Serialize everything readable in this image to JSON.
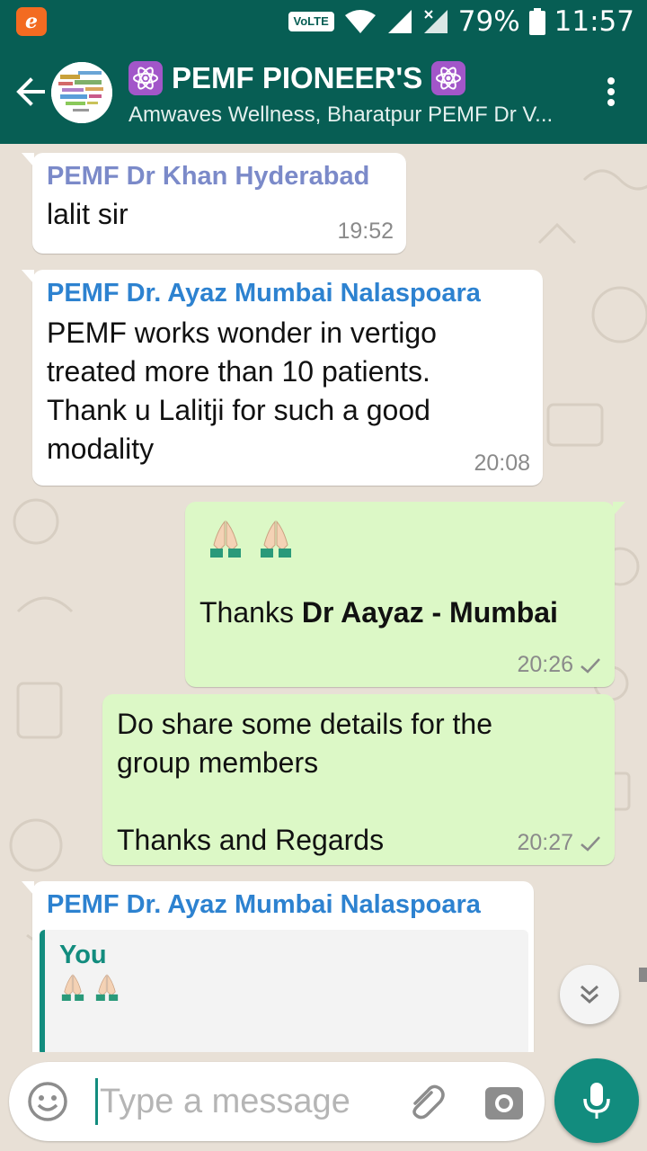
{
  "status_bar": {
    "network": "VoLTE",
    "battery": "79%",
    "time": "11:57"
  },
  "header": {
    "title": "PEMF PIONEER'S",
    "subtitle": "Amwaves Wellness, Bharatpur PEMF Dr V...",
    "icons": [
      "back-arrow-icon",
      "atom-icon",
      "more-vert-icon"
    ]
  },
  "messages": [
    {
      "direction": "incoming",
      "sender": "PEMF Dr Khan Hyderabad",
      "sender_color": "#7b8ac9",
      "text": "lalit sir",
      "time": "19:52"
    },
    {
      "direction": "incoming",
      "sender": "PEMF Dr. Ayaz Mumbai Nalaspoara",
      "sender_color": "#2d82d0",
      "lines": [
        "PEMF works wonder in vertigo",
        "treated more than 10 patients.",
        "Thank u Lalitji for such a good",
        "modality"
      ],
      "time": "20:08"
    },
    {
      "direction": "outgoing",
      "emoji": "folded-hands-icon",
      "text_plain": "Thanks ",
      "text_bold": "Dr Aayaz - Mumbai",
      "time": "20:26",
      "status": "sent"
    },
    {
      "direction": "outgoing",
      "lines": [
        "Do share some details for the",
        "group members",
        "",
        "Thanks and Regards"
      ],
      "time": "20:27",
      "status": "sent"
    },
    {
      "direction": "incoming",
      "sender": "PEMF Dr. Ayaz Mumbai Nalaspoara",
      "sender_color": "#2d82d0",
      "quote": {
        "name": "You",
        "emoji": "folded-hands-icon"
      }
    }
  ],
  "composer": {
    "placeholder": "Type a message"
  },
  "colors": {
    "header": "#075e54",
    "outgoing_bubble": "#dcf8c6",
    "accent": "#128c7e"
  }
}
